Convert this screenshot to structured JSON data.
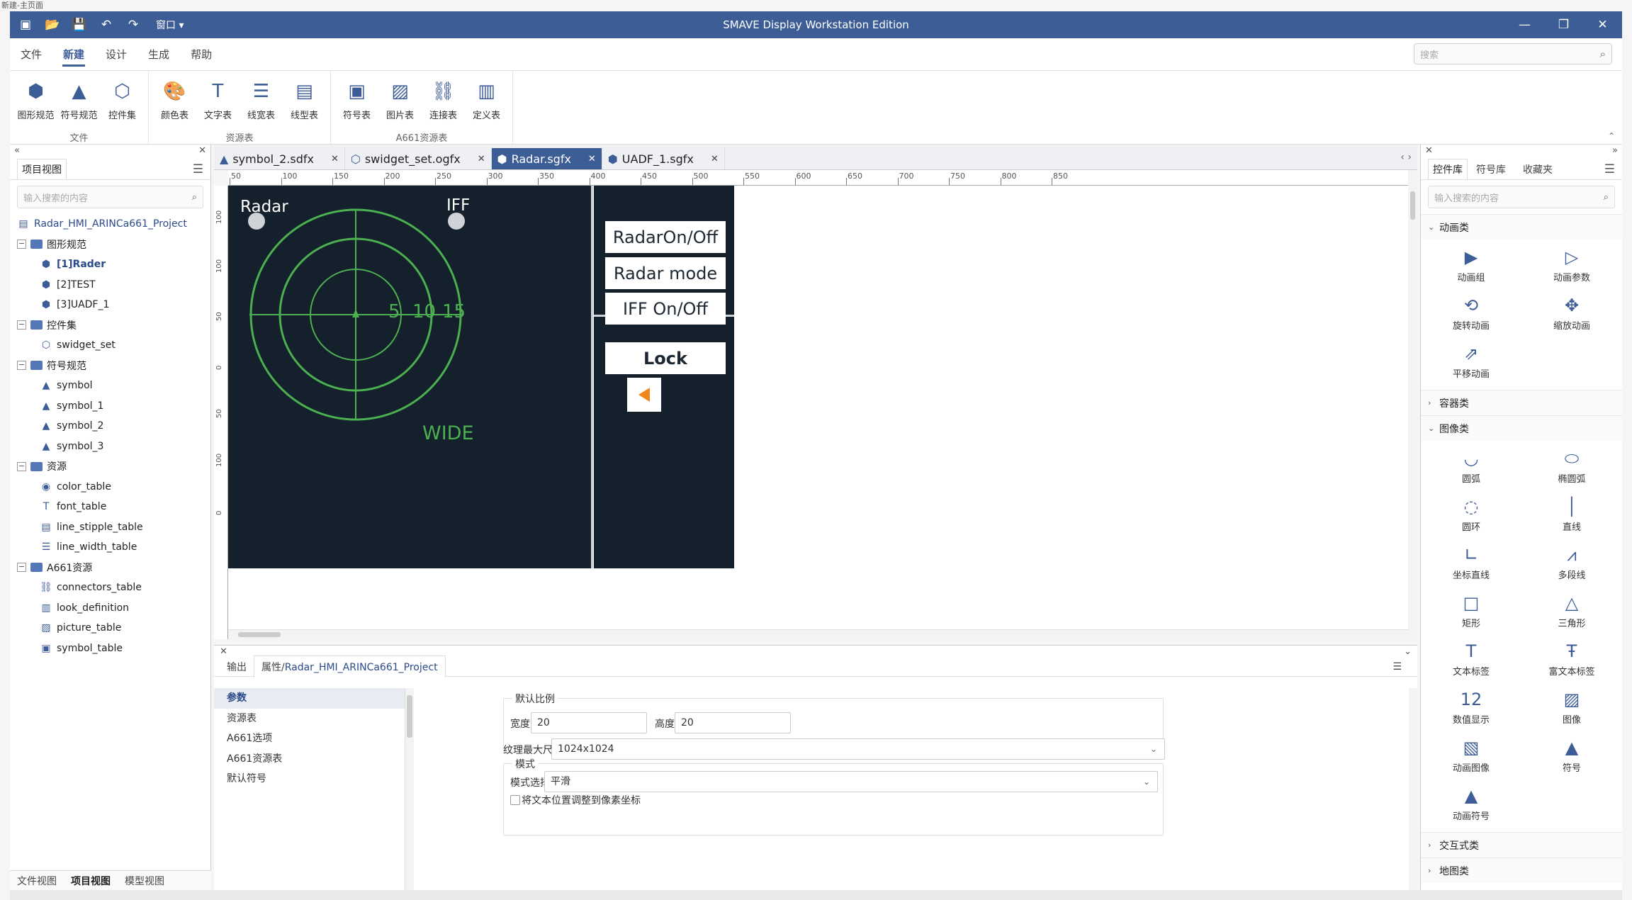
{
  "window_label": "新建-主页面",
  "title": "SMAVE Display Workstation Edition",
  "window_menu_label": "窗口",
  "menu": [
    "文件",
    "新建",
    "设计",
    "生成",
    "帮助"
  ],
  "menu_active": 1,
  "search_placeholder": "搜索",
  "ribbon": {
    "groups": [
      {
        "label": "文件",
        "buttons": [
          {
            "label": "图形规范",
            "icon": "cube-icon"
          },
          {
            "label": "符号规范",
            "icon": "symbol-icon"
          },
          {
            "label": "控件集",
            "icon": "widget-set-icon"
          }
        ]
      },
      {
        "label": "资源表",
        "buttons": [
          {
            "label": "颜色表",
            "icon": "palette-icon"
          },
          {
            "label": "文字表",
            "icon": "text-icon"
          },
          {
            "label": "线宽表",
            "icon": "line-width-icon"
          },
          {
            "label": "线型表",
            "icon": "line-stipple-icon"
          }
        ]
      },
      {
        "label": "A661资源表",
        "buttons": [
          {
            "label": "符号表",
            "icon": "symbol-table-icon"
          },
          {
            "label": "图片表",
            "icon": "picture-icon"
          },
          {
            "label": "连接表",
            "icon": "link-icon"
          },
          {
            "label": "定义表",
            "icon": "definition-icon"
          }
        ]
      }
    ],
    "collapse_glyph": "⌃"
  },
  "left_pane": {
    "tab": "项目视图",
    "search_placeholder": "输入搜索的内容",
    "tree": [
      {
        "label": "Radar_HMI_ARINCa661_Project",
        "level": 0,
        "kind": "project"
      },
      {
        "label": "图形规范",
        "level": 1,
        "kind": "folder"
      },
      {
        "label": "[1]Rader",
        "level": 2,
        "kind": "cube",
        "selected": true
      },
      {
        "label": "[2]TEST",
        "level": 2,
        "kind": "cube"
      },
      {
        "label": "[3]UADF_1",
        "level": 2,
        "kind": "cube"
      },
      {
        "label": "控件集",
        "level": 1,
        "kind": "folder"
      },
      {
        "label": "swidget_set",
        "level": 2,
        "kind": "widgetset"
      },
      {
        "label": "符号规范",
        "level": 1,
        "kind": "folder"
      },
      {
        "label": "symbol",
        "level": 2,
        "kind": "symbol"
      },
      {
        "label": "symbol_1",
        "level": 2,
        "kind": "symbol"
      },
      {
        "label": "symbol_2",
        "level": 2,
        "kind": "symbol"
      },
      {
        "label": "symbol_3",
        "level": 2,
        "kind": "symbol"
      },
      {
        "label": "资源",
        "level": 1,
        "kind": "folder"
      },
      {
        "label": "color_table",
        "level": 2,
        "kind": "palette"
      },
      {
        "label": "font_table",
        "level": 2,
        "kind": "font"
      },
      {
        "label": "line_stipple_table",
        "level": 2,
        "kind": "stipple"
      },
      {
        "label": "line_width_table",
        "level": 2,
        "kind": "width"
      },
      {
        "label": "A661资源",
        "level": 1,
        "kind": "folder"
      },
      {
        "label": "connectors_table",
        "level": 2,
        "kind": "link"
      },
      {
        "label": "look_definition",
        "level": 2,
        "kind": "definition"
      },
      {
        "label": "picture_table",
        "level": 2,
        "kind": "picture"
      },
      {
        "label": "symbol_table",
        "level": 2,
        "kind": "symboltable"
      }
    ],
    "bottom_tabs": [
      "文件视图",
      "项目视图",
      "模型视图"
    ],
    "bottom_active": 1
  },
  "doc_tabs": [
    {
      "label": "symbol_2.sdfx",
      "icon": "symbol-icon"
    },
    {
      "label": "swidget_set.ogfx",
      "icon": "widget-set-icon"
    },
    {
      "label": "Radar.sgfx",
      "icon": "cube-icon",
      "active": true
    },
    {
      "label": "UADF_1.sgfx",
      "icon": "cube-icon"
    }
  ],
  "ruler": {
    "h_labels": [
      "50",
      "100",
      "150",
      "200",
      "250",
      "300",
      "350",
      "400",
      "450",
      "500",
      "550",
      "600",
      "650",
      "700",
      "750",
      "800",
      "850"
    ],
    "v_labels": [
      "100",
      "100",
      "50",
      "0",
      "50",
      "100",
      "0"
    ]
  },
  "radar": {
    "label_radar": "Radar",
    "label_iff": "IFF",
    "range_labels": [
      "5",
      "10",
      "15"
    ],
    "mode_label": "WIDE",
    "buttons": [
      "RadarOn/Off",
      "Radar mode",
      "IFF On/Off",
      "Lock"
    ],
    "ring_color": "#4caf50",
    "bg_color": "#14202c",
    "arrow_color": "#f0861c"
  },
  "bottom_pane": {
    "tabs": [
      {
        "label": "输出"
      },
      {
        "label": "属性/",
        "link": "Radar_HMI_ARINCa661_Project"
      }
    ],
    "nav": [
      "参数",
      "资源表",
      "A661选项",
      "A661资源表",
      "默认符号"
    ],
    "nav_active": 0,
    "default_scale_legend": "默认比例",
    "width_label": "宽度:",
    "width_value": "20",
    "height_label": "高度:",
    "height_value": "20",
    "texture_label": "纹理最大尺寸:",
    "texture_value": "1024x1024",
    "mode_legend": "模式",
    "mode_select_label": "模式选择:",
    "mode_value": "平滑",
    "checkbox_label": "将文本位置调整到像素坐标"
  },
  "right_pane": {
    "tabs": [
      "控件库",
      "符号库",
      "收藏夹"
    ],
    "tab_active": 0,
    "search_placeholder": "输入搜索的内容",
    "sections": [
      {
        "label": "动画类",
        "open": true,
        "items": [
          {
            "label": "动画组",
            "icon": "anim-group-icon"
          },
          {
            "label": "动画参数",
            "icon": "anim-param-icon"
          },
          {
            "label": "旋转动画",
            "icon": "rotate-anim-icon"
          },
          {
            "label": "缩放动画",
            "icon": "scale-anim-icon"
          },
          {
            "label": "平移动画",
            "icon": "translate-anim-icon"
          }
        ]
      },
      {
        "label": "容器类",
        "open": false,
        "items": []
      },
      {
        "label": "图像类",
        "open": true,
        "items": [
          {
            "label": "圆弧",
            "icon": "arc-icon"
          },
          {
            "label": "椭圆弧",
            "icon": "ellipse-icon"
          },
          {
            "label": "圆环",
            "icon": "ring-icon"
          },
          {
            "label": "直线",
            "icon": "line-icon"
          },
          {
            "label": "坐标直线",
            "icon": "axis-line-icon"
          },
          {
            "label": "多段线",
            "icon": "polyline-icon"
          },
          {
            "label": "矩形",
            "icon": "rect-icon"
          },
          {
            "label": "三角形",
            "icon": "triangle-icon"
          },
          {
            "label": "文本标签",
            "icon": "text-label-icon"
          },
          {
            "label": "富文本标签",
            "icon": "rich-text-icon"
          },
          {
            "label": "数值显示",
            "icon": "numeric-icon"
          },
          {
            "label": "图像",
            "icon": "image-icon"
          },
          {
            "label": "动画图像",
            "icon": "anim-image-icon"
          },
          {
            "label": "符号",
            "icon": "symbol-icon"
          },
          {
            "label": "动画符号",
            "icon": "anim-symbol-icon"
          }
        ]
      },
      {
        "label": "交互式类",
        "open": false,
        "items": []
      },
      {
        "label": "地图类",
        "open": false,
        "items": []
      }
    ]
  }
}
